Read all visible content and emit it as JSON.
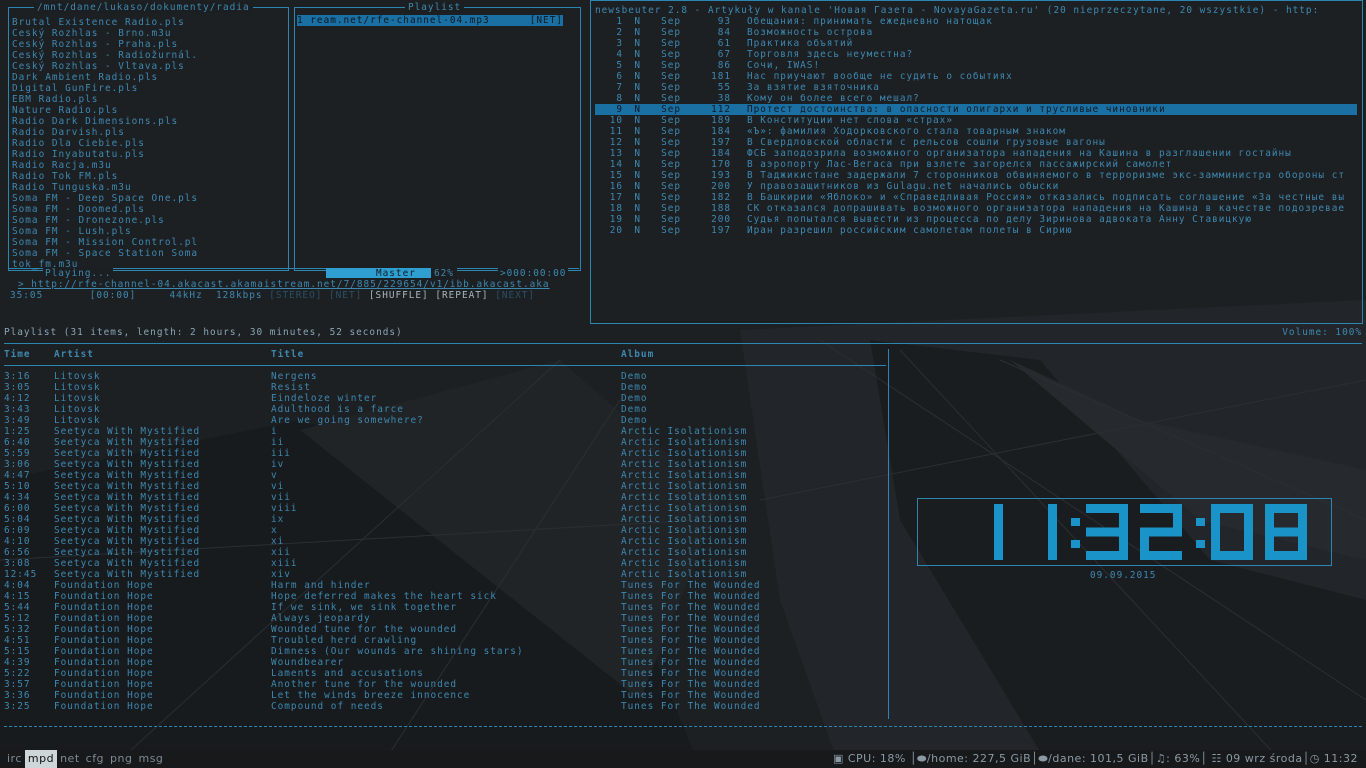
{
  "colors": {
    "accent": "#2d86b0",
    "text": "#3e88b0",
    "highlight": "#1a6fa3",
    "background": "#1c1f22"
  },
  "ncmpcpp": {
    "browser_title": "/mnt/dane/lukaso/dokumenty/radia",
    "browser_items": [
      "Brutal Existence Radio.pls",
      "Český Rozhlas - Brno.m3u",
      "Český Rozhlas - Praha.pls",
      "Český Rozhlas - Radiožurnál.",
      "Český Rozhlas - Vltava.pls",
      "Dark Ambient Radio.pls",
      "Digital GunFire.pls",
      "EBM Radio.pls",
      "Nature Radio.pls",
      "Radio Dark Dimensions.pls",
      "Radio Darvish.pls",
      "Radio Dla Ciebie.pls",
      "Radio Inyabutatu.pls",
      "Radio Racja.m3u",
      "Radio Tok FM.pls",
      "Radio Tunguska.m3u",
      "Soma FM - Deep Space One.pls",
      "Soma FM - Doomed.pls",
      "Soma FM - Dronezone.pls",
      "Soma FM - Lush.pls",
      "Soma FM - Mission Control.pl",
      "Soma FM - Space Station Soma",
      "tok_fm.m3u"
    ],
    "playlist_title": "Playlist",
    "playlist_item": "1 ream.net/rfe-channel-04.mp3",
    "playlist_tag": "[NET]",
    "playing_label": "Playing...",
    "master_label": "Master",
    "volume": "62%",
    "elapsed": ">000:00:00",
    "now_playing": "> http://rfe-channel-04.akacast.akamaistream.net/7/885/229654/v1/ibb.akacast.aka",
    "time": "35:05",
    "track_time": "[00:00]",
    "rate": "44kHz",
    "bitrate": "128kbps",
    "flags": [
      {
        "label": "[STEREO]",
        "on": false
      },
      {
        "label": "[NET]",
        "on": false
      },
      {
        "label": "[SHUFFLE]",
        "on": true
      },
      {
        "label": "[REPEAT]",
        "on": true
      },
      {
        "label": "[NEXT]",
        "on": false
      }
    ]
  },
  "newsbeuter": {
    "header": "newsbeuter 2.8 - Artykuły w kanale 'Новая Газета - NovayaGazeta.ru' (20 nieprzeczytane, 20 wszystkie) - http:",
    "items": [
      {
        "n": "1",
        "flag": "N",
        "mon": "Sep",
        "len": "93",
        "title": "Обещания: принимать ежедневно натощак"
      },
      {
        "n": "2",
        "flag": "N",
        "mon": "Sep",
        "len": "84",
        "title": "Возможность острова"
      },
      {
        "n": "3",
        "flag": "N",
        "mon": "Sep",
        "len": "61",
        "title": "Практика объятий"
      },
      {
        "n": "4",
        "flag": "N",
        "mon": "Sep",
        "len": "67",
        "title": "Торговля здесь неуместна?"
      },
      {
        "n": "5",
        "flag": "N",
        "mon": "Sep",
        "len": "86",
        "title": "Сочи, IWAS!"
      },
      {
        "n": "6",
        "flag": "N",
        "mon": "Sep",
        "len": "181",
        "title": "Нас приучают вообще не судить о событиях"
      },
      {
        "n": "7",
        "flag": "N",
        "mon": "Sep",
        "len": "55",
        "title": "За взятие взяточника"
      },
      {
        "n": "8",
        "flag": "N",
        "mon": "Sep",
        "len": "38",
        "title": "Кому он более всего мешал?"
      },
      {
        "n": "9",
        "flag": "N",
        "mon": "Sep",
        "len": "112",
        "title": "Протест достоинства: в опасности олигархи и трусливые чиновники"
      },
      {
        "n": "10",
        "flag": "N",
        "mon": "Sep",
        "len": "189",
        "title": "В Конституции нет слова «страх»"
      },
      {
        "n": "11",
        "flag": "N",
        "mon": "Sep",
        "len": "184",
        "title": "«Ъ»: фамилия Ходорковского стала товарным знаком"
      },
      {
        "n": "12",
        "flag": "N",
        "mon": "Sep",
        "len": "197",
        "title": "В Свердловской области с рельсов сошли грузовые вагоны"
      },
      {
        "n": "13",
        "flag": "N",
        "mon": "Sep",
        "len": "184",
        "title": "ФСБ заподозрила возможного организатора нападения на Кашина в разглашении гостайны"
      },
      {
        "n": "14",
        "flag": "N",
        "mon": "Sep",
        "len": "170",
        "title": "В аэропорту Лас-Вегаса при взлете загорелся пассажирский самолет"
      },
      {
        "n": "15",
        "flag": "N",
        "mon": "Sep",
        "len": "193",
        "title": "В Таджикистане задержали 7 сторонников обвиняемого в терроризме экс-замминистра обороны ст"
      },
      {
        "n": "16",
        "flag": "N",
        "mon": "Sep",
        "len": "200",
        "title": "У правозащитников из Gulagu.net начались обыски"
      },
      {
        "n": "17",
        "flag": "N",
        "mon": "Sep",
        "len": "182",
        "title": "В Башкирии «Яблоко» и «Справедливая Россия» отказались подписать соглашение «За честные вы"
      },
      {
        "n": "18",
        "flag": "N",
        "mon": "Sep",
        "len": "188",
        "title": "СК отказался допрашивать возможного организатора нападения на Кашина в качестве подозревае"
      },
      {
        "n": "19",
        "flag": "N",
        "mon": "Sep",
        "len": "200",
        "title": "Судья попытался вывести из процесса по делу Зиринова адвоката Анну Ставицкую"
      },
      {
        "n": "20",
        "flag": "N",
        "mon": "Sep",
        "len": "197",
        "title": "Иран разрешил российским самолетам полеты в Сирию"
      }
    ],
    "selected_index": 8
  },
  "playlist": {
    "header": "Playlist (31 items, length: 2 hours, 30 minutes, 52 seconds)",
    "volume": "Volume: 100%",
    "columns": {
      "time": "Time",
      "artist": "Artist",
      "title": "Title",
      "album": "Album"
    },
    "rows": [
      [
        "3:16",
        "Litovsk",
        "Nergens",
        "Demo"
      ],
      [
        "3:05",
        "Litovsk",
        "Resist",
        "Demo"
      ],
      [
        "4:12",
        "Litovsk",
        "Eindeloze winter",
        "Demo"
      ],
      [
        "3:43",
        "Litovsk",
        "Adulthood is a farce",
        "Demo"
      ],
      [
        "3:49",
        "Litovsk",
        "Are we going somewhere?",
        "Demo"
      ],
      [
        "1:25",
        "Seetyca With Mystified",
        "i",
        "Arctic Isolationism"
      ],
      [
        "6:40",
        "Seetyca With Mystified",
        "ii",
        "Arctic Isolationism"
      ],
      [
        "5:59",
        "Seetyca With Mystified",
        "iii",
        "Arctic Isolationism"
      ],
      [
        "3:06",
        "Seetyca With Mystified",
        "iv",
        "Arctic Isolationism"
      ],
      [
        "4:47",
        "Seetyca With Mystified",
        "v",
        "Arctic Isolationism"
      ],
      [
        "5:10",
        "Seetyca With Mystified",
        "vi",
        "Arctic Isolationism"
      ],
      [
        "4:34",
        "Seetyca With Mystified",
        "vii",
        "Arctic Isolationism"
      ],
      [
        "6:00",
        "Seetyca With Mystified",
        "viii",
        "Arctic Isolationism"
      ],
      [
        "5:04",
        "Seetyca With Mystified",
        "ix",
        "Arctic Isolationism"
      ],
      [
        "6:09",
        "Seetyca With Mystified",
        "x",
        "Arctic Isolationism"
      ],
      [
        "4:10",
        "Seetyca With Mystified",
        "xi",
        "Arctic Isolationism"
      ],
      [
        "6:56",
        "Seetyca With Mystified",
        "xii",
        "Arctic Isolationism"
      ],
      [
        "3:08",
        "Seetyca With Mystified",
        "xiii",
        "Arctic Isolationism"
      ],
      [
        "12:45",
        "Seetyca With Mystified",
        "xiv",
        "Arctic Isolationism"
      ],
      [
        "4:04",
        "Foundation Hope",
        "Harm and hinder",
        "Tunes For The Wounded"
      ],
      [
        "4:15",
        "Foundation Hope",
        "Hope deferred makes the heart sick",
        "Tunes For The Wounded"
      ],
      [
        "5:44",
        "Foundation Hope",
        "If we sink, we sink together",
        "Tunes For The Wounded"
      ],
      [
        "5:12",
        "Foundation Hope",
        "Always jeopardy",
        "Tunes For The Wounded"
      ],
      [
        "5:32",
        "Foundation Hope",
        "Wounded tune for the wounded",
        "Tunes For The Wounded"
      ],
      [
        "4:51",
        "Foundation Hope",
        "Troubled herd crawling",
        "Tunes For The Wounded"
      ],
      [
        "5:15",
        "Foundation Hope",
        "Dimness (Our wounds are shining stars)",
        "Tunes For The Wounded"
      ],
      [
        "4:39",
        "Foundation Hope",
        "Woundbearer",
        "Tunes For The Wounded"
      ],
      [
        "5:22",
        "Foundation Hope",
        "Laments and accusations",
        "Tunes For The Wounded"
      ],
      [
        "3:57",
        "Foundation Hope",
        "Another tune for the wounded",
        "Tunes For The Wounded"
      ],
      [
        "3:36",
        "Foundation Hope",
        "Let the winds breeze innocence",
        "Tunes For The Wounded"
      ],
      [
        "3:25",
        "Foundation Hope",
        "Compound of needs",
        "Tunes For The Wounded"
      ]
    ]
  },
  "clock": {
    "time": "11:32:08",
    "date": "09.09.2015"
  },
  "statusbar": {
    "workspaces": [
      "irc",
      "mpd",
      "net",
      "cfg",
      "png",
      "msg"
    ],
    "active_workspace": "mpd",
    "cpu": "CPU: 18%",
    "home": "/home: 227,5 GiB",
    "dane": "/dane: 101,5 GiB",
    "volume": "63%",
    "date": "09 wrz środa",
    "time": "11:32",
    "icons": [
      "cpu-icon",
      "disk-icon",
      "disk-icon",
      "music-icon",
      "calendar-icon",
      "clock-icon"
    ]
  }
}
